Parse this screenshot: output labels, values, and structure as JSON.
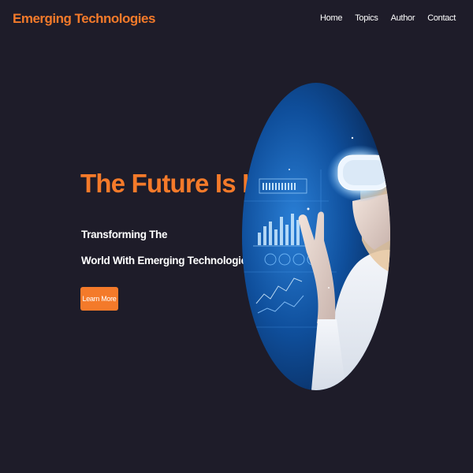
{
  "brand": {
    "name": "Emerging Technologies"
  },
  "nav": {
    "items": [
      {
        "label": "Home"
      },
      {
        "label": "Topics"
      },
      {
        "label": "Author"
      },
      {
        "label": "Contact"
      }
    ]
  },
  "hero": {
    "title": "The Future Is Here",
    "subtitle_line1": "Transforming The",
    "subtitle_line2": "World With Emerging Technologies",
    "cta_label": "Learn More",
    "image_subject": "woman-wearing-vr-headset-with-holographic-interface"
  },
  "colors": {
    "background": "#1e1c29",
    "accent": "#f47a2a",
    "text": "#ffffff"
  }
}
